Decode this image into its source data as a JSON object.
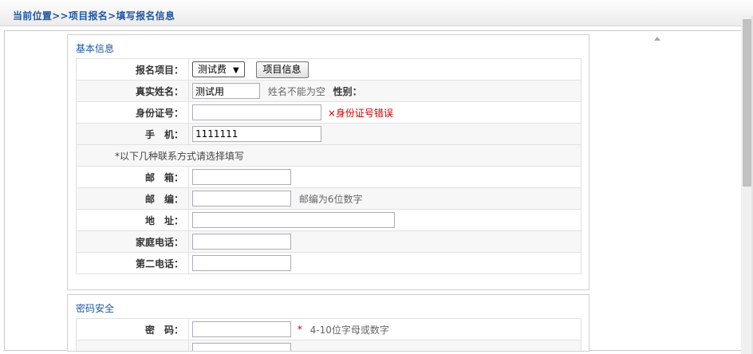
{
  "breadcrumb": "当前位置>>项目报名>填写报名信息",
  "basic": {
    "title": "基本信息",
    "project_label": "报名项目：",
    "project_value": "测试费",
    "project_info_button": "项目信息",
    "realname_label": "真实姓名：",
    "realname_value": "测试用",
    "realname_hint": "姓名不能为空",
    "gender_label": "性别：",
    "idcard_label": "身份证号：",
    "idcard_error": "×身份证号错误",
    "phone_label": "手　机：",
    "phone_value": "1111111",
    "contact_note": "*以下几种联系方式请选择填写",
    "email_label": "邮　箱：",
    "zip_label": "邮　编：",
    "zip_hint": "邮编为6位数字",
    "address_label": "地　址：",
    "home_phone_label": "家庭电话：",
    "second_phone_label": "第二电话："
  },
  "security": {
    "title": "密码安全",
    "password_label": "密　码：",
    "password_required": "*",
    "password_hint": "4-10位字母或数字"
  }
}
